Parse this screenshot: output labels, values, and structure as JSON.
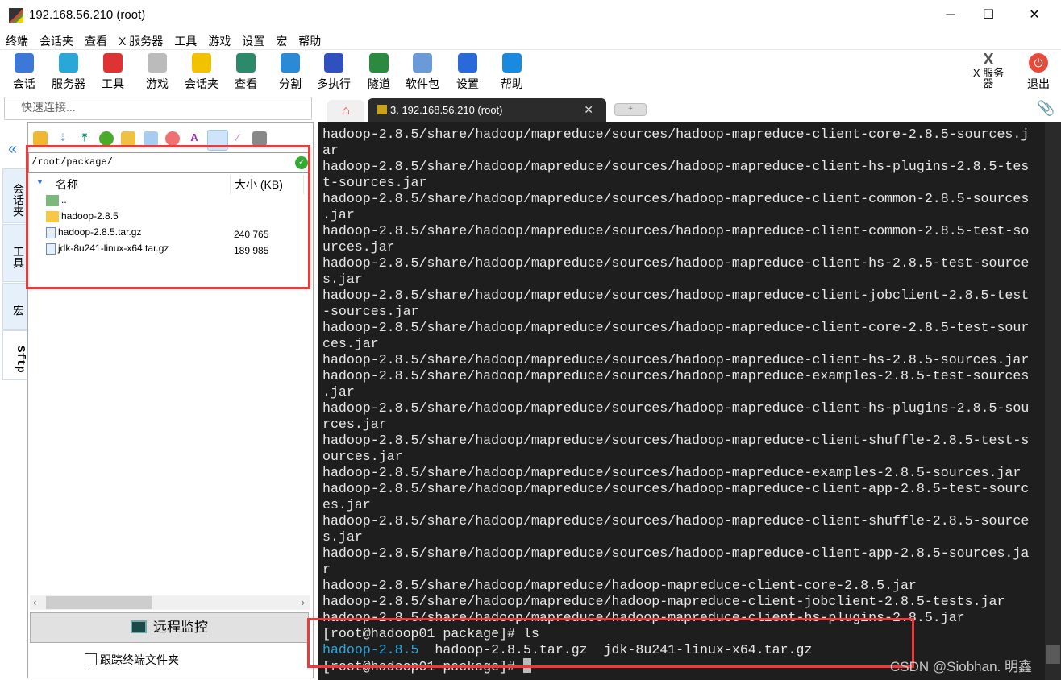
{
  "window": {
    "title": "192.168.56.210 (root)",
    "minimize": "─",
    "maximize": "☐",
    "close": "✕"
  },
  "menu": [
    "终端",
    "会话夹",
    "查看",
    "X 服务器",
    "工具",
    "游戏",
    "设置",
    "宏",
    "帮助"
  ],
  "toolbar": [
    {
      "label": "会话",
      "icon": "session-icon",
      "color": "#3c78d8"
    },
    {
      "label": "服务器",
      "icon": "servers-icon",
      "color": "#2aa7d8"
    },
    {
      "label": "工具",
      "icon": "tools-icon",
      "color": "#d33"
    },
    {
      "label": "游戏",
      "icon": "games-icon",
      "color": "#bbb"
    },
    {
      "label": "会话夹",
      "icon": "star-icon",
      "color": "#f2c200"
    },
    {
      "label": "查看",
      "icon": "view-icon",
      "color": "#2c8a6a"
    },
    {
      "label": "分割",
      "icon": "split-icon",
      "color": "#2a8ad8"
    },
    {
      "label": "多执行",
      "icon": "multiexec-icon",
      "color": "#3050c0"
    },
    {
      "label": "隧道",
      "icon": "tunnel-icon",
      "color": "#2a8a40"
    },
    {
      "label": "软件包",
      "icon": "packages-icon",
      "color": "#6a9ad8"
    },
    {
      "label": "设置",
      "icon": "settings-icon",
      "color": "#2a6ad8"
    },
    {
      "label": "帮助",
      "icon": "help-icon",
      "color": "#1a8ae0"
    }
  ],
  "toolbar_right": {
    "xserver": "X 服务器",
    "exit": "退出"
  },
  "quick_connect": {
    "placeholder": "快速连接..."
  },
  "tabs": {
    "home_icon": "⌂",
    "session": "3. 192.168.56.210 (root)",
    "close": "✕",
    "new": "+"
  },
  "sidetabs": [
    "会话夹",
    "工具",
    "宏",
    "Sftp"
  ],
  "sftp": {
    "path": "/root/package/",
    "col_name": "名称",
    "col_size": "大小 (KB)",
    "files": [
      {
        "name": "..",
        "size": "",
        "type": "parent"
      },
      {
        "name": "hadoop-2.8.5",
        "size": "",
        "type": "folder"
      },
      {
        "name": "hadoop-2.8.5.tar.gz",
        "size": "240 765",
        "type": "file"
      },
      {
        "name": "jdk-8u241-linux-x64.tar.gz",
        "size": "189 985",
        "type": "file"
      }
    ],
    "monitor": "远程监控",
    "follow": "跟踪终端文件夹"
  },
  "terminal": {
    "lines": [
      "hadoop-2.8.5/share/hadoop/mapreduce/sources/hadoop-mapreduce-client-core-2.8.5-sources.j",
      "ar",
      "hadoop-2.8.5/share/hadoop/mapreduce/sources/hadoop-mapreduce-client-hs-plugins-2.8.5-tes",
      "t-sources.jar",
      "hadoop-2.8.5/share/hadoop/mapreduce/sources/hadoop-mapreduce-client-common-2.8.5-sources",
      ".jar",
      "hadoop-2.8.5/share/hadoop/mapreduce/sources/hadoop-mapreduce-client-common-2.8.5-test-so",
      "urces.jar",
      "hadoop-2.8.5/share/hadoop/mapreduce/sources/hadoop-mapreduce-client-hs-2.8.5-test-source",
      "s.jar",
      "hadoop-2.8.5/share/hadoop/mapreduce/sources/hadoop-mapreduce-client-jobclient-2.8.5-test",
      "-sources.jar",
      "hadoop-2.8.5/share/hadoop/mapreduce/sources/hadoop-mapreduce-client-core-2.8.5-test-sour",
      "ces.jar",
      "hadoop-2.8.5/share/hadoop/mapreduce/sources/hadoop-mapreduce-client-hs-2.8.5-sources.jar",
      "hadoop-2.8.5/share/hadoop/mapreduce/sources/hadoop-mapreduce-examples-2.8.5-test-sources",
      ".jar",
      "hadoop-2.8.5/share/hadoop/mapreduce/sources/hadoop-mapreduce-client-hs-plugins-2.8.5-sou",
      "rces.jar",
      "hadoop-2.8.5/share/hadoop/mapreduce/sources/hadoop-mapreduce-client-shuffle-2.8.5-test-s",
      "ources.jar",
      "hadoop-2.8.5/share/hadoop/mapreduce/sources/hadoop-mapreduce-examples-2.8.5-sources.jar",
      "hadoop-2.8.5/share/hadoop/mapreduce/sources/hadoop-mapreduce-client-app-2.8.5-test-sourc",
      "es.jar",
      "hadoop-2.8.5/share/hadoop/mapreduce/sources/hadoop-mapreduce-client-shuffle-2.8.5-source",
      "s.jar",
      "hadoop-2.8.5/share/hadoop/mapreduce/sources/hadoop-mapreduce-client-app-2.8.5-sources.ja",
      "r",
      "hadoop-2.8.5/share/hadoop/mapreduce/hadoop-mapreduce-client-core-2.8.5.jar",
      "hadoop-2.8.5/share/hadoop/mapreduce/hadoop-mapreduce-client-jobclient-2.8.5-tests.jar",
      "hadoop-2.8.5/share/hadoop/mapreduce/hadoop-mapreduce-client-hs-plugins-2.8.5.jar",
      "[root@hadoop01 package]# ls"
    ],
    "ls_dir": "hadoop-2.8.5",
    "ls_files": "  hadoop-2.8.5.tar.gz  jdk-8u241-linux-x64.tar.gz",
    "prompt": "[root@hadoop01 package]# "
  },
  "watermark": "CSDN @Siobhan. 明鑫"
}
